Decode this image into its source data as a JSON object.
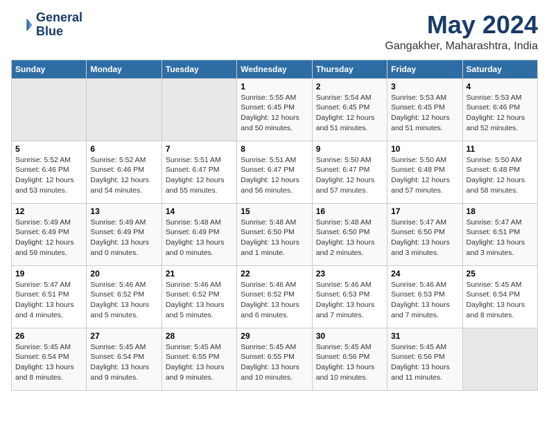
{
  "logo": {
    "line1": "General",
    "line2": "Blue"
  },
  "title": "May 2024",
  "location": "Gangakher, Maharashtra, India",
  "days_of_week": [
    "Sunday",
    "Monday",
    "Tuesday",
    "Wednesday",
    "Thursday",
    "Friday",
    "Saturday"
  ],
  "weeks": [
    [
      {
        "num": "",
        "info": ""
      },
      {
        "num": "",
        "info": ""
      },
      {
        "num": "",
        "info": ""
      },
      {
        "num": "1",
        "info": "Sunrise: 5:55 AM\nSunset: 6:45 PM\nDaylight: 12 hours\nand 50 minutes."
      },
      {
        "num": "2",
        "info": "Sunrise: 5:54 AM\nSunset: 6:45 PM\nDaylight: 12 hours\nand 51 minutes."
      },
      {
        "num": "3",
        "info": "Sunrise: 5:53 AM\nSunset: 6:45 PM\nDaylight: 12 hours\nand 51 minutes."
      },
      {
        "num": "4",
        "info": "Sunrise: 5:53 AM\nSunset: 6:46 PM\nDaylight: 12 hours\nand 52 minutes."
      }
    ],
    [
      {
        "num": "5",
        "info": "Sunrise: 5:52 AM\nSunset: 6:46 PM\nDaylight: 12 hours\nand 53 minutes."
      },
      {
        "num": "6",
        "info": "Sunrise: 5:52 AM\nSunset: 6:46 PM\nDaylight: 12 hours\nand 54 minutes."
      },
      {
        "num": "7",
        "info": "Sunrise: 5:51 AM\nSunset: 6:47 PM\nDaylight: 12 hours\nand 55 minutes."
      },
      {
        "num": "8",
        "info": "Sunrise: 5:51 AM\nSunset: 6:47 PM\nDaylight: 12 hours\nand 56 minutes."
      },
      {
        "num": "9",
        "info": "Sunrise: 5:50 AM\nSunset: 6:47 PM\nDaylight: 12 hours\nand 57 minutes."
      },
      {
        "num": "10",
        "info": "Sunrise: 5:50 AM\nSunset: 6:48 PM\nDaylight: 12 hours\nand 57 minutes."
      },
      {
        "num": "11",
        "info": "Sunrise: 5:50 AM\nSunset: 6:48 PM\nDaylight: 12 hours\nand 58 minutes."
      }
    ],
    [
      {
        "num": "12",
        "info": "Sunrise: 5:49 AM\nSunset: 6:49 PM\nDaylight: 12 hours\nand 59 minutes."
      },
      {
        "num": "13",
        "info": "Sunrise: 5:49 AM\nSunset: 6:49 PM\nDaylight: 13 hours\nand 0 minutes."
      },
      {
        "num": "14",
        "info": "Sunrise: 5:48 AM\nSunset: 6:49 PM\nDaylight: 13 hours\nand 0 minutes."
      },
      {
        "num": "15",
        "info": "Sunrise: 5:48 AM\nSunset: 6:50 PM\nDaylight: 13 hours\nand 1 minute."
      },
      {
        "num": "16",
        "info": "Sunrise: 5:48 AM\nSunset: 6:50 PM\nDaylight: 13 hours\nand 2 minutes."
      },
      {
        "num": "17",
        "info": "Sunrise: 5:47 AM\nSunset: 6:50 PM\nDaylight: 13 hours\nand 3 minutes."
      },
      {
        "num": "18",
        "info": "Sunrise: 5:47 AM\nSunset: 6:51 PM\nDaylight: 13 hours\nand 3 minutes."
      }
    ],
    [
      {
        "num": "19",
        "info": "Sunrise: 5:47 AM\nSunset: 6:51 PM\nDaylight: 13 hours\nand 4 minutes."
      },
      {
        "num": "20",
        "info": "Sunrise: 5:46 AM\nSunset: 6:52 PM\nDaylight: 13 hours\nand 5 minutes."
      },
      {
        "num": "21",
        "info": "Sunrise: 5:46 AM\nSunset: 6:52 PM\nDaylight: 13 hours\nand 5 minutes."
      },
      {
        "num": "22",
        "info": "Sunrise: 5:46 AM\nSunset: 6:52 PM\nDaylight: 13 hours\nand 6 minutes."
      },
      {
        "num": "23",
        "info": "Sunrise: 5:46 AM\nSunset: 6:53 PM\nDaylight: 13 hours\nand 7 minutes."
      },
      {
        "num": "24",
        "info": "Sunrise: 5:46 AM\nSunset: 6:53 PM\nDaylight: 13 hours\nand 7 minutes."
      },
      {
        "num": "25",
        "info": "Sunrise: 5:45 AM\nSunset: 6:54 PM\nDaylight: 13 hours\nand 8 minutes."
      }
    ],
    [
      {
        "num": "26",
        "info": "Sunrise: 5:45 AM\nSunset: 6:54 PM\nDaylight: 13 hours\nand 8 minutes."
      },
      {
        "num": "27",
        "info": "Sunrise: 5:45 AM\nSunset: 6:54 PM\nDaylight: 13 hours\nand 9 minutes."
      },
      {
        "num": "28",
        "info": "Sunrise: 5:45 AM\nSunset: 6:55 PM\nDaylight: 13 hours\nand 9 minutes."
      },
      {
        "num": "29",
        "info": "Sunrise: 5:45 AM\nSunset: 6:55 PM\nDaylight: 13 hours\nand 10 minutes."
      },
      {
        "num": "30",
        "info": "Sunrise: 5:45 AM\nSunset: 6:56 PM\nDaylight: 13 hours\nand 10 minutes."
      },
      {
        "num": "31",
        "info": "Sunrise: 5:45 AM\nSunset: 6:56 PM\nDaylight: 13 hours\nand 11 minutes."
      },
      {
        "num": "",
        "info": ""
      }
    ]
  ]
}
